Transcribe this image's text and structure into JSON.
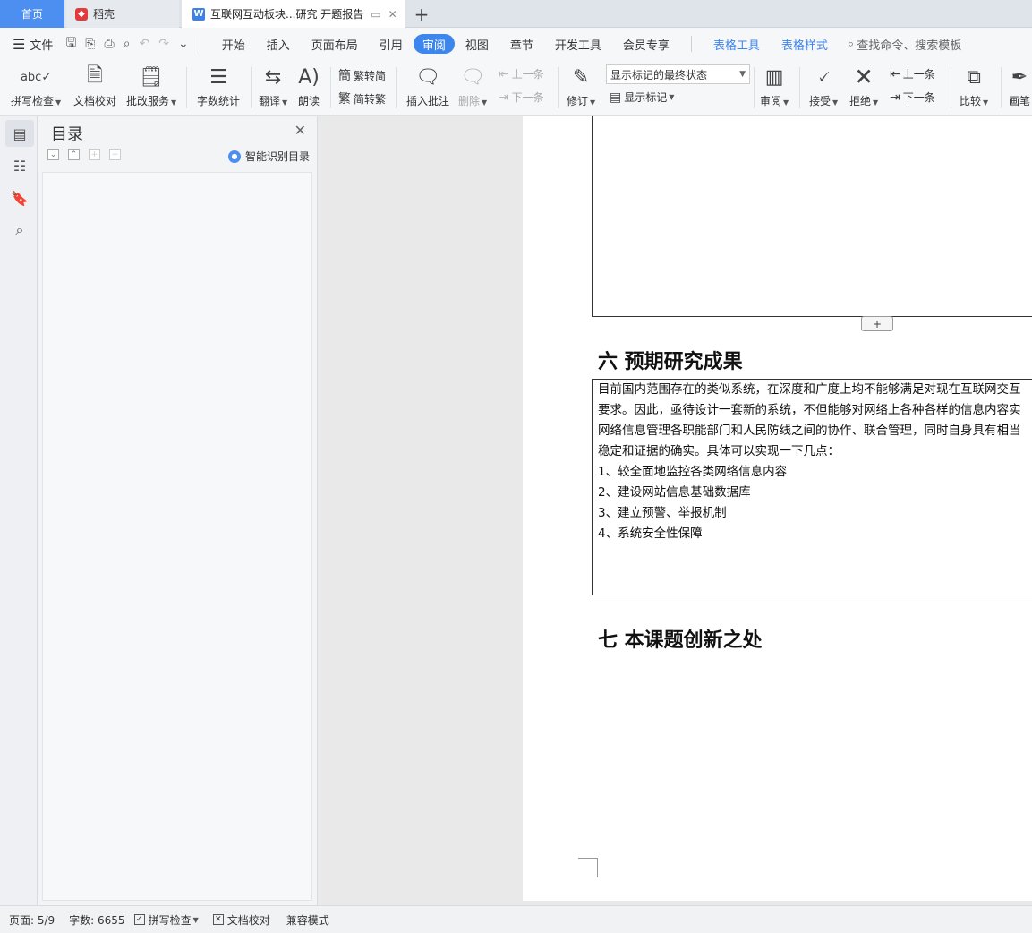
{
  "tabs": {
    "home": "首页",
    "daoke": "稻壳",
    "doc": "互联网互动板块...研究 开题报告"
  },
  "menu": {
    "file": "文件",
    "items": [
      "开始",
      "插入",
      "页面布局",
      "引用",
      "审阅",
      "视图",
      "章节",
      "开发工具",
      "会员专享"
    ],
    "context": [
      "表格工具",
      "表格样式"
    ],
    "search": "查找命令、搜索模板"
  },
  "ribbon": {
    "spell_check": "拼写检查",
    "doc_proof": "文档校对",
    "review_service": "批改服务",
    "word_count": "字数统计",
    "translate": "翻译",
    "read_aloud": "朗读",
    "trad_to_simp": "繁转简",
    "simp_to_trad": "简转繁",
    "insert_comment": "插入批注",
    "delete": "删除",
    "prev_comment": "上一条",
    "next_comment": "下一条",
    "track": "修订",
    "markup_state": "显示标记的最终状态",
    "show_markup": "显示标记",
    "review": "审阅",
    "accept": "接受",
    "reject": "拒绝",
    "prev_change": "上一条",
    "next_change": "下一条",
    "compare": "比较",
    "pen": "画笔"
  },
  "toc": {
    "title": "目录",
    "smart": "智能识别目录"
  },
  "document": {
    "section6_title": "六 预期研究成果",
    "section6_lines": [
      "目前国内范围存在的类似系统，在深度和广度上均不能够满足对现在互联网交互",
      "要求。因此，亟待设计一套新的系统，不但能够对网络上各种各样的信息内容实",
      "网络信息管理各职能部门和人民防线之间的协作、联合管理，同时自身具有相当",
      "稳定和证据的确实。具体可以实现一下几点：",
      "1、较全面地监控各类网络信息内容",
      "2、建设网站信息基础数据库",
      "3、建立预警、举报机制",
      "4、系统安全性保障"
    ],
    "section7_title": "七 本课题创新之处"
  },
  "status": {
    "page": "页面: 5/9",
    "word_count": "字数: 6655",
    "spell_check": "拼写检查",
    "doc_proof": "文档校对",
    "compat_mode": "兼容模式"
  },
  "colors": {
    "accent": "#3d86ee",
    "tab_home": "#4c8ff0"
  }
}
